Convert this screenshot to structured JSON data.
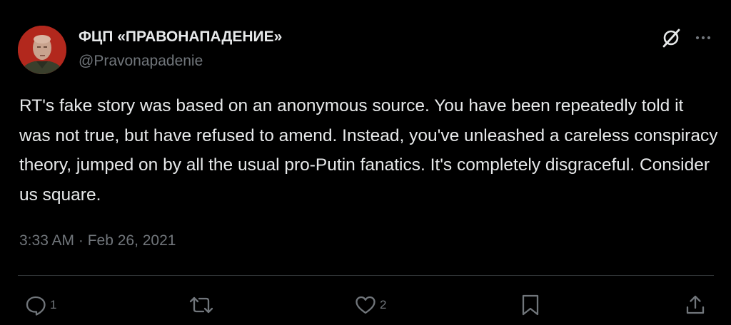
{
  "tweet": {
    "display_name": "ФЦП «ПРАВОНАПАДЕНИЕ»",
    "handle": "@Pravonapadenie",
    "text": "RT's fake story was based on an anonymous source. You have been repeatedly told it was not true, but have refused to amend. Instead, you've unleashed a careless conspiracy theory, jumped on by all the usual pro-Putin fanatics. It's completely disgraceful. Consider us square.",
    "timestamp": "3:33 AM · Feb 26, 2021",
    "reply_count": "1",
    "like_count": "2"
  },
  "icons": {
    "grok": "grok-icon",
    "more": "more-icon",
    "reply": "reply-icon",
    "retweet": "retweet-icon",
    "like": "like-icon",
    "bookmark": "bookmark-icon",
    "share": "share-icon"
  },
  "colors": {
    "background": "#000000",
    "primary_text": "#e7e9ea",
    "secondary_text": "#71767b",
    "divider": "#2f3336",
    "avatar_bg": "#b2281d"
  }
}
